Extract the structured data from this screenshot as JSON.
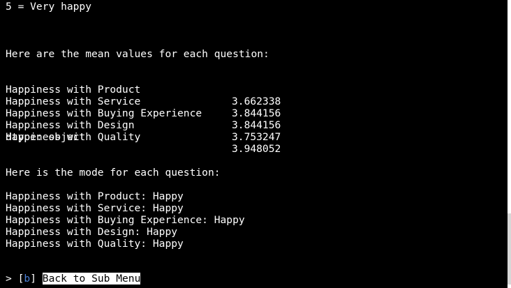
{
  "terminal": {
    "scale_line": "5 = Very happy",
    "means_heading": "Here are the mean values for each question:",
    "means": [
      {
        "label": "Happiness with Product",
        "value": "3.662338"
      },
      {
        "label": "Happiness with Service",
        "value": "3.844156"
      },
      {
        "label": "Happiness with Buying Experience",
        "value": "3.844156"
      },
      {
        "label": "Happiness with Design",
        "value": "3.753247"
      },
      {
        "label": "Happiness with Quality",
        "value": "3.948052"
      }
    ],
    "dtype_line": "dtype: object",
    "mode_heading": "Here is the mode for each question:",
    "modes": [
      "Happiness with Product: Happy",
      "Happiness with Service: Happy",
      "Happiness with Buying Experience: Happy",
      "Happiness with Design: Happy",
      "Happiness with Quality: Happy"
    ],
    "prompt": {
      "cursor": ">",
      "open_bracket": "[",
      "key": "b",
      "close_bracket": "]",
      "label": "Back to Sub Menu"
    }
  },
  "colors": {
    "background": "#000000",
    "text": "#ffffff",
    "key_highlight": "#4a7fd4",
    "selected_bg": "#ffffff",
    "scrollbar_track": "#ffffff",
    "scrollbar_thumb": "#d7d7d7"
  }
}
